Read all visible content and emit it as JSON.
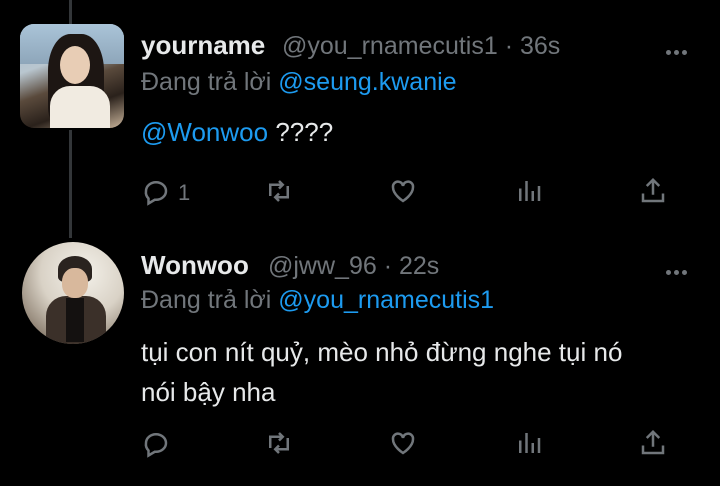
{
  "tweets": [
    {
      "name": "yourname",
      "handle": "@you_rnamecutis1",
      "time": "36s",
      "reply_prefix": "Đang trả lời",
      "reply_to": "@seung.kwanie",
      "text_mention": "@Wonwoo",
      "text": " ????",
      "reply_count": "1"
    },
    {
      "name": "Wonwoo",
      "handle": "@jww_96",
      "time": "22s",
      "reply_prefix": "Đang trả lời",
      "reply_to": "@you_rnamecutis1",
      "text_line1": "tụi con nít quỷ, mèo nhỏ đừng nghe tụi nó",
      "text_line2": "nói bậy nha",
      "reply_count": ""
    }
  ],
  "separator": "·",
  "icons": [
    "reply-icon",
    "retweet-icon",
    "like-icon",
    "analytics-icon",
    "share-icon",
    "more-icon"
  ],
  "colors": {
    "background": "#000000",
    "text": "#e7e9ea",
    "muted": "#71767b",
    "link": "#1d9bf0"
  }
}
